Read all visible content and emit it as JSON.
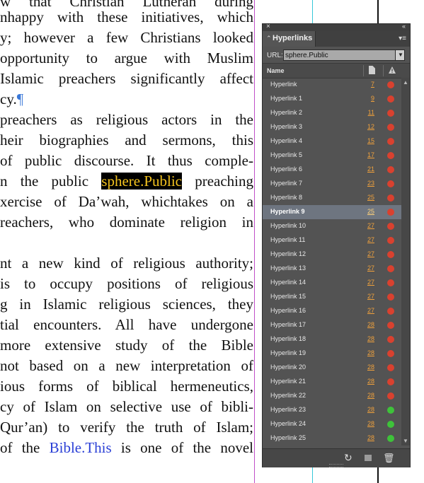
{
  "document": {
    "lines": [
      {
        "pre": "w that Christian Lutheran during",
        "hl": "",
        "post": "",
        "link": "",
        "tail": "",
        "pilcrow": ""
      },
      {
        "pre": "nhappy with these initiatives, which",
        "hl": "",
        "post": "",
        "link": "",
        "tail": "",
        "pilcrow": ""
      },
      {
        "pre": "y; however a few Christians looked",
        "hl": "",
        "post": "",
        "link": "",
        "tail": "",
        "pilcrow": ""
      },
      {
        "pre": "opportunity to argue with Muslim",
        "hl": "",
        "post": "",
        "link": "",
        "tail": "",
        "pilcrow": ""
      },
      {
        "pre": "Islamic preachers significantly affect",
        "hl": "",
        "post": "",
        "link": "",
        "tail": "",
        "pilcrow": ""
      },
      {
        "pre": "cy.",
        "hl": "",
        "post": "",
        "link": "",
        "tail": "",
        "pilcrow": "¶"
      },
      {
        "pre": "preachers as religious actors in the",
        "hl": "",
        "post": "",
        "link": "",
        "tail": "",
        "pilcrow": ""
      },
      {
        "pre": "heir biographies and sermons, this",
        "hl": "",
        "post": "",
        "link": "",
        "tail": "",
        "pilcrow": ""
      },
      {
        "pre": "of public discourse. It thus comple-",
        "hl": "",
        "post": "",
        "link": "",
        "tail": "",
        "pilcrow": ""
      },
      {
        "pre": "n the public ",
        "hl": "sphere.Public",
        "post": " preaching",
        "link": "",
        "tail": "",
        "pilcrow": ""
      },
      {
        "pre": "xercise of Da’wah, whichtakes on a",
        "hl": "",
        "post": "",
        "link": "",
        "tail": "",
        "pilcrow": ""
      },
      {
        "pre": "reachers, who dominate religion in",
        "hl": "",
        "post": "",
        "link": "",
        "tail": "",
        "pilcrow": ""
      },
      {
        "pre": "",
        "hl": "",
        "post": "",
        "link": "",
        "tail": "",
        "pilcrow": ""
      },
      {
        "pre": "nt a new kind of religious authority;",
        "hl": "",
        "post": "",
        "link": "",
        "tail": "",
        "pilcrow": ""
      },
      {
        "pre": " is to occupy positions of religious",
        "hl": "",
        "post": "",
        "link": "",
        "tail": "",
        "pilcrow": ""
      },
      {
        "pre": "g in Islamic religious sciences, they",
        "hl": "",
        "post": "",
        "link": "",
        "tail": "",
        "pilcrow": ""
      },
      {
        "pre": "tial encounters. All have undergone",
        "hl": "",
        "post": "",
        "link": "",
        "tail": "",
        "pilcrow": ""
      },
      {
        "pre": "more extensive study of the Bible",
        "hl": "",
        "post": "",
        "link": "",
        "tail": "",
        "pilcrow": ""
      },
      {
        "pre": "not based on a new interpretation of",
        "hl": "",
        "post": "",
        "link": "",
        "tail": "",
        "pilcrow": ""
      },
      {
        "pre": "ious forms of biblical hermeneutics,",
        "hl": "",
        "post": "",
        "link": "",
        "tail": "",
        "pilcrow": ""
      },
      {
        "pre": "cy of Islam on selective use of bibli-",
        "hl": "",
        "post": "",
        "link": "",
        "tail": "",
        "pilcrow": ""
      },
      {
        "pre": "Qur’an) to verify the truth of Islam;",
        "hl": "",
        "post": "",
        "link": "",
        "tail": "",
        "pilcrow": ""
      },
      {
        "pre": " of the ",
        "hl": "",
        "post": "",
        "link": "Bible.This",
        "tail": " is one of the novel",
        "pilcrow": ""
      }
    ]
  },
  "panel": {
    "title": "Hyperlinks",
    "url_label": "URL:",
    "url_value": "sphere.Public",
    "column_name": "Name",
    "selected_index": 9,
    "colors": {
      "red": "#d9412f",
      "green": "#3ec23a"
    },
    "items": [
      {
        "name": "Hyperlink",
        "page": "7",
        "status": "red"
      },
      {
        "name": "Hyperlink 1",
        "page": "9",
        "status": "red"
      },
      {
        "name": "Hyperlink 2",
        "page": "11",
        "status": "red"
      },
      {
        "name": "Hyperlink 3",
        "page": "12",
        "status": "red"
      },
      {
        "name": "Hyperlink 4",
        "page": "15",
        "status": "red"
      },
      {
        "name": "Hyperlink 5",
        "page": "17",
        "status": "red"
      },
      {
        "name": "Hyperlink 6",
        "page": "21",
        "status": "red"
      },
      {
        "name": "Hyperlink 7",
        "page": "23",
        "status": "red"
      },
      {
        "name": "Hyperlink 8",
        "page": "25",
        "status": "red"
      },
      {
        "name": "Hyperlink 9",
        "page": "25",
        "status": "red"
      },
      {
        "name": "Hyperlink 10",
        "page": "27",
        "status": "red"
      },
      {
        "name": "Hyperlink 11",
        "page": "27",
        "status": "red"
      },
      {
        "name": "Hyperlink 12",
        "page": "27",
        "status": "red"
      },
      {
        "name": "Hyperlink 13",
        "page": "27",
        "status": "red"
      },
      {
        "name": "Hyperlink 14",
        "page": "27",
        "status": "red"
      },
      {
        "name": "Hyperlink 15",
        "page": "27",
        "status": "red"
      },
      {
        "name": "Hyperlink 16",
        "page": "27",
        "status": "red"
      },
      {
        "name": "Hyperlink 17",
        "page": "28",
        "status": "red"
      },
      {
        "name": "Hyperlink 18",
        "page": "28",
        "status": "red"
      },
      {
        "name": "Hyperlink 19",
        "page": "28",
        "status": "red"
      },
      {
        "name": "Hyperlink 20",
        "page": "28",
        "status": "red"
      },
      {
        "name": "Hyperlink 21",
        "page": "28",
        "status": "red"
      },
      {
        "name": "Hyperlink 22",
        "page": "28",
        "status": "red"
      },
      {
        "name": "Hyperlink 23",
        "page": "28",
        "status": "green"
      },
      {
        "name": "Hyperlink 24",
        "page": "28",
        "status": "green"
      },
      {
        "name": "Hyperlink 25",
        "page": "28",
        "status": "green"
      }
    ],
    "icons": {
      "close": "close-icon",
      "collapse": "collapse-icon",
      "menu": "panel-menu-icon",
      "page_column": "page-icon",
      "status_column": "warning-icon",
      "refresh": "refresh-icon",
      "new": "new-hyperlink-icon",
      "delete": "trash-icon"
    }
  }
}
